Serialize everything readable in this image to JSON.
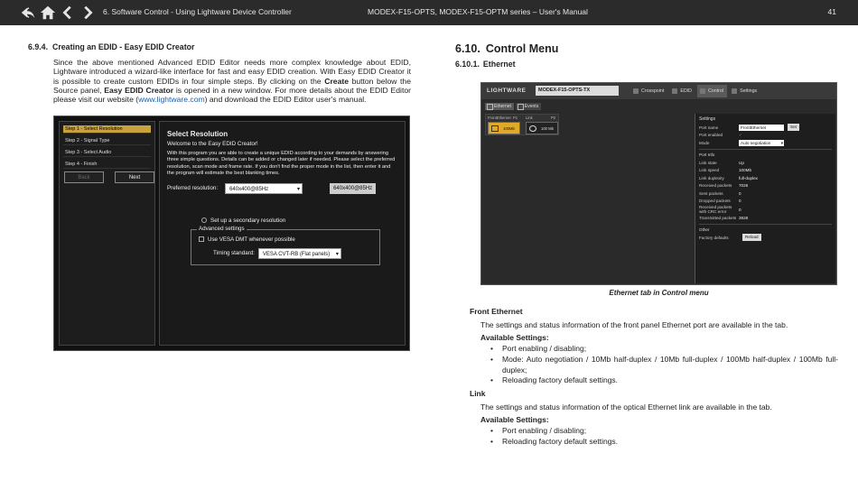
{
  "header": {
    "chapter": "6. Software Control - Using Lightware Device Controller",
    "manual": "MODEX-F15-OPTS, MODEX-F15-OPTM series – User's Manual",
    "page": "41",
    "nav_icons": [
      "back-icon",
      "home-icon",
      "previous-icon",
      "next-icon"
    ]
  },
  "left": {
    "section_number": "6.9.4.",
    "section_title": "Creating an EDID - Easy EDID Creator",
    "para_a": "Since the above mentioned Advanced EDID Editor needs more complex knowledge about EDID, Lightware introduced a wizard-like interface for fast and easy EDID creation. With Easy EDID Creator it is possible to create custom EDIDs in four simple steps. By clicking on the ",
    "para_create": "Create",
    "para_b": " button below the Source panel, ",
    "para_eec": "Easy EDID Creator",
    "para_c": " is opened in a new window. For more details about the EDID Editor please visit our website (",
    "link": "www.lightware.com",
    "para_d": ") and download the EDID Editor user's manual.",
    "wizard": {
      "steps": [
        "Step 1 - Select Resolution",
        "Step 2 - Signal Type",
        "Step 3 - Select Audio",
        "Step 4 - Finish"
      ],
      "back": "Back",
      "next": "Next",
      "title": "Select Resolution",
      "welcome": "Welcome to the Easy EDID Creator!",
      "text": "With this program you are able to create a unique EDID according to your demands by answering three simple questions. Details can be added or changed later if needed. Please select the preferred resolution, scan mode and frame rate. If you don't find the proper mode in the list, then enter it and the program will estimate the best blanking times.",
      "preferred_label": "Preferred resolution:",
      "preferred_value": "640x400@85Hz",
      "preferred_badge": "640x400@85Hz",
      "secondary": "Set up a secondary resolution",
      "advanced": "Advanced settings",
      "vesa_dmt": "Use VESA DMT whenever possible",
      "timing_label": "Timing standard:",
      "timing_value": "VESA CVT-RB (Flat panels)"
    }
  },
  "right": {
    "h1_number": "6.10.",
    "h1_title": "Control Menu",
    "h2_number": "6.10.1.",
    "h2_title": "Ethernet",
    "ldc": {
      "logo": "LIGHTWARE",
      "device": "MODEX-F15-OPTS-TX",
      "menu": [
        "Crosspoint",
        "EDID",
        "Control",
        "Settings"
      ],
      "tabs": [
        "Ethernet",
        "Events"
      ],
      "port_front": "FrontEthernet",
      "port_front_no": "P1",
      "port_link": "Link",
      "port_link_no": "P2",
      "port_front_speed": "100Mb",
      "port_link_speed": "100 Mb",
      "settings_title": "Settings",
      "port_name_k": "Port name",
      "port_name_v": "FrontEthernet",
      "set": "Set",
      "port_enabled_k": "Port enabled",
      "port_enabled_v": "✓",
      "mode_k": "Mode",
      "mode_v": "Auto negotiation",
      "port_info": "Port Info",
      "link_state_k": "Link state",
      "link_state_v": "Up",
      "link_speed_k": "Link speed",
      "link_speed_v": "100Mb",
      "link_duplex_k": "Link duplexity",
      "link_duplex_v": "full-duplex",
      "recv_k": "Received packets",
      "recv_v": "7026",
      "sent_k": "Sent packets",
      "sent_v": "0",
      "dropped_k": "Dropped packets",
      "dropped_v": "0",
      "crc_k": "Received packets with CRC error",
      "crc_v": "0",
      "trans_k": "Transmitted packets",
      "trans_v": "3928",
      "other": "Other",
      "factory_k": "Factory defaults",
      "reload": "Reload"
    },
    "caption": "Ethernet tab in Control menu",
    "front_title": "Front Ethernet",
    "front_desc": "The settings and status information of the front panel Ethernet port are available in the tab.",
    "available": "Available Settings:",
    "front_items": [
      "Port enabling / disabling;",
      "Mode: Auto negotiation / 10Mb half-duplex / 10Mb full-duplex / 100Mb half-duplex / 100Mb full-duplex;",
      "Reloading factory default settings."
    ],
    "link_title": "Link",
    "link_desc": "The settings and status information of the optical Ethernet link are available in the tab.",
    "link_items": [
      "Port enabling / disabling;",
      "Reloading factory default settings."
    ]
  }
}
